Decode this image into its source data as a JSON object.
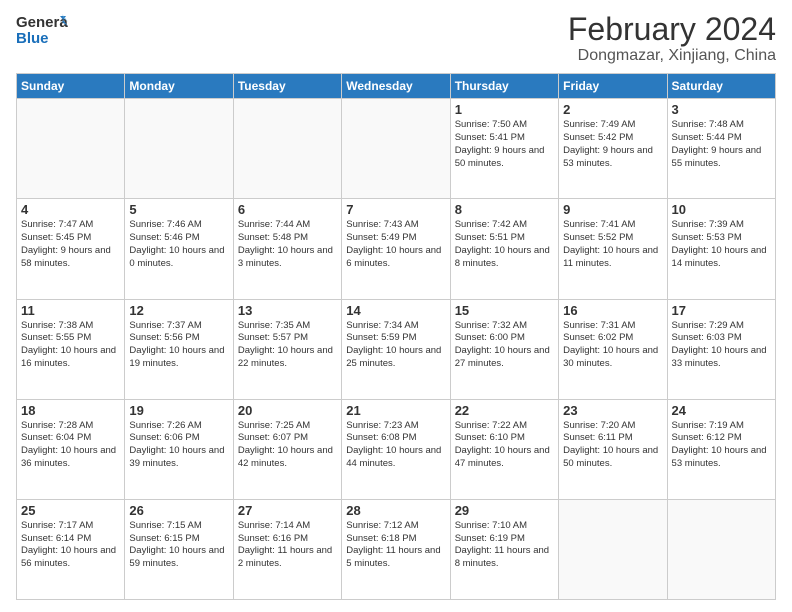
{
  "header": {
    "logo_line1": "General",
    "logo_line2": "Blue",
    "main_title": "February 2024",
    "subtitle": "Dongmazar, Xinjiang, China"
  },
  "days_of_week": [
    "Sunday",
    "Monday",
    "Tuesday",
    "Wednesday",
    "Thursday",
    "Friday",
    "Saturday"
  ],
  "weeks": [
    [
      {
        "day": "",
        "info": ""
      },
      {
        "day": "",
        "info": ""
      },
      {
        "day": "",
        "info": ""
      },
      {
        "day": "",
        "info": ""
      },
      {
        "day": "1",
        "info": "Sunrise: 7:50 AM\nSunset: 5:41 PM\nDaylight: 9 hours\nand 50 minutes."
      },
      {
        "day": "2",
        "info": "Sunrise: 7:49 AM\nSunset: 5:42 PM\nDaylight: 9 hours\nand 53 minutes."
      },
      {
        "day": "3",
        "info": "Sunrise: 7:48 AM\nSunset: 5:44 PM\nDaylight: 9 hours\nand 55 minutes."
      }
    ],
    [
      {
        "day": "4",
        "info": "Sunrise: 7:47 AM\nSunset: 5:45 PM\nDaylight: 9 hours\nand 58 minutes."
      },
      {
        "day": "5",
        "info": "Sunrise: 7:46 AM\nSunset: 5:46 PM\nDaylight: 10 hours\nand 0 minutes."
      },
      {
        "day": "6",
        "info": "Sunrise: 7:44 AM\nSunset: 5:48 PM\nDaylight: 10 hours\nand 3 minutes."
      },
      {
        "day": "7",
        "info": "Sunrise: 7:43 AM\nSunset: 5:49 PM\nDaylight: 10 hours\nand 6 minutes."
      },
      {
        "day": "8",
        "info": "Sunrise: 7:42 AM\nSunset: 5:51 PM\nDaylight: 10 hours\nand 8 minutes."
      },
      {
        "day": "9",
        "info": "Sunrise: 7:41 AM\nSunset: 5:52 PM\nDaylight: 10 hours\nand 11 minutes."
      },
      {
        "day": "10",
        "info": "Sunrise: 7:39 AM\nSunset: 5:53 PM\nDaylight: 10 hours\nand 14 minutes."
      }
    ],
    [
      {
        "day": "11",
        "info": "Sunrise: 7:38 AM\nSunset: 5:55 PM\nDaylight: 10 hours\nand 16 minutes."
      },
      {
        "day": "12",
        "info": "Sunrise: 7:37 AM\nSunset: 5:56 PM\nDaylight: 10 hours\nand 19 minutes."
      },
      {
        "day": "13",
        "info": "Sunrise: 7:35 AM\nSunset: 5:57 PM\nDaylight: 10 hours\nand 22 minutes."
      },
      {
        "day": "14",
        "info": "Sunrise: 7:34 AM\nSunset: 5:59 PM\nDaylight: 10 hours\nand 25 minutes."
      },
      {
        "day": "15",
        "info": "Sunrise: 7:32 AM\nSunset: 6:00 PM\nDaylight: 10 hours\nand 27 minutes."
      },
      {
        "day": "16",
        "info": "Sunrise: 7:31 AM\nSunset: 6:02 PM\nDaylight: 10 hours\nand 30 minutes."
      },
      {
        "day": "17",
        "info": "Sunrise: 7:29 AM\nSunset: 6:03 PM\nDaylight: 10 hours\nand 33 minutes."
      }
    ],
    [
      {
        "day": "18",
        "info": "Sunrise: 7:28 AM\nSunset: 6:04 PM\nDaylight: 10 hours\nand 36 minutes."
      },
      {
        "day": "19",
        "info": "Sunrise: 7:26 AM\nSunset: 6:06 PM\nDaylight: 10 hours\nand 39 minutes."
      },
      {
        "day": "20",
        "info": "Sunrise: 7:25 AM\nSunset: 6:07 PM\nDaylight: 10 hours\nand 42 minutes."
      },
      {
        "day": "21",
        "info": "Sunrise: 7:23 AM\nSunset: 6:08 PM\nDaylight: 10 hours\nand 44 minutes."
      },
      {
        "day": "22",
        "info": "Sunrise: 7:22 AM\nSunset: 6:10 PM\nDaylight: 10 hours\nand 47 minutes."
      },
      {
        "day": "23",
        "info": "Sunrise: 7:20 AM\nSunset: 6:11 PM\nDaylight: 10 hours\nand 50 minutes."
      },
      {
        "day": "24",
        "info": "Sunrise: 7:19 AM\nSunset: 6:12 PM\nDaylight: 10 hours\nand 53 minutes."
      }
    ],
    [
      {
        "day": "25",
        "info": "Sunrise: 7:17 AM\nSunset: 6:14 PM\nDaylight: 10 hours\nand 56 minutes."
      },
      {
        "day": "26",
        "info": "Sunrise: 7:15 AM\nSunset: 6:15 PM\nDaylight: 10 hours\nand 59 minutes."
      },
      {
        "day": "27",
        "info": "Sunrise: 7:14 AM\nSunset: 6:16 PM\nDaylight: 11 hours\nand 2 minutes."
      },
      {
        "day": "28",
        "info": "Sunrise: 7:12 AM\nSunset: 6:18 PM\nDaylight: 11 hours\nand 5 minutes."
      },
      {
        "day": "29",
        "info": "Sunrise: 7:10 AM\nSunset: 6:19 PM\nDaylight: 11 hours\nand 8 minutes."
      },
      {
        "day": "",
        "info": ""
      },
      {
        "day": "",
        "info": ""
      }
    ]
  ]
}
